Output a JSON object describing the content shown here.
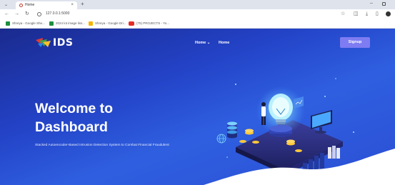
{
  "browser": {
    "tab_title": "Home",
    "url": "127.0.0.1:5000",
    "bookmarks": [
      {
        "label": "Shreya - Google She...",
        "color": "#1e8e3e"
      },
      {
        "label": "2024 lot image liss...",
        "color": "#1e8e3e"
      },
      {
        "label": "Shreya - Google Dri...",
        "color": "#f4b400"
      },
      {
        "label": "(75) PROJECTS - Yo...",
        "color": "#e52d27"
      }
    ]
  },
  "header": {
    "logo_text": "IDS",
    "nav": [
      {
        "label": "Home ⌄"
      },
      {
        "label": "Home"
      }
    ],
    "signup_label": "Signup"
  },
  "hero": {
    "title_line1": "Welcome to",
    "title_line2": "Dashboard",
    "subtitle": "Stacked Autoencoder-Based Intrusion Detection System to Combat Financial Fraudulent"
  },
  "colors": {
    "gradient_dark": "#1a2a8e",
    "gradient_mid": "#2f5fe0",
    "signup_button": "#7e7cf2",
    "bulb_glow": "#7fe7ff",
    "coin": "#ffc83a"
  },
  "icons": [
    "menu-icon",
    "site-favicon",
    "close-icon",
    "new-tab-icon",
    "minimize-icon",
    "maximize-icon",
    "back-icon",
    "forward-icon",
    "reload-icon",
    "info-icon",
    "star-icon",
    "extensions-icon",
    "download-icon",
    "side-panel-icon",
    "profile-icon",
    "light-bulb-icon",
    "server-icon",
    "globe-icon",
    "monitor-icon",
    "books-icon"
  ]
}
